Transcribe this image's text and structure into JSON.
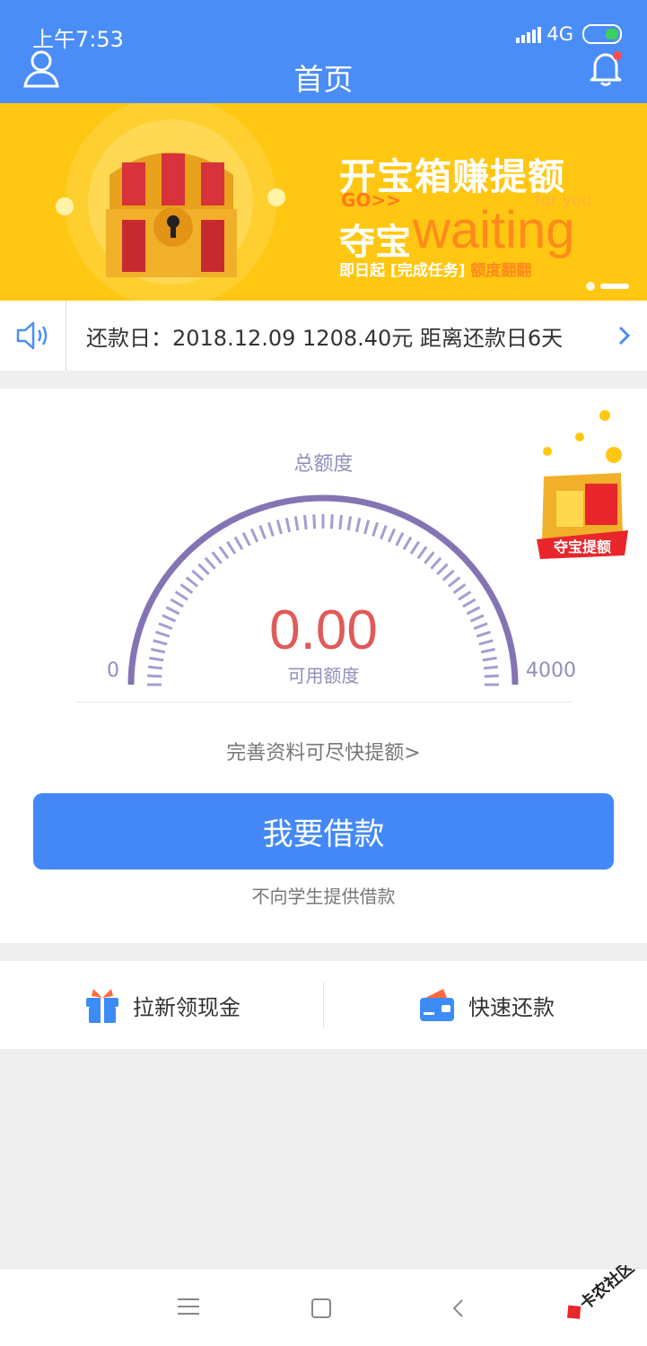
{
  "status_bar": {
    "time": "上午7:53",
    "network": "4G"
  },
  "header": {
    "title": "首页"
  },
  "banner": {
    "title": "开宝箱赚提额",
    "go_text": "GO>>",
    "duobao": "夺宝",
    "waiting": "waiting",
    "for_you": "for you",
    "subtitle_prefix": "即日起 [完成任务]",
    "subtitle_highlight": "额度翻翻",
    "page_count": 2,
    "active_page": 2
  },
  "notice": {
    "text": "还款日：2018.12.09  1208.40元  距离还款日6天"
  },
  "credit": {
    "total_label": "总额度",
    "amount": "0.00",
    "available_label": "可用额度",
    "min": "0",
    "max": "4000",
    "improve_link": "完善资料可尽快提额>",
    "borrow_button": "我要借款",
    "disclaimer": "不向学生提供借款",
    "treasure_badge": "夺宝提额"
  },
  "actions": [
    {
      "label": "拉新领现金",
      "icon": "gift-icon"
    },
    {
      "label": "快速还款",
      "icon": "card-icon"
    }
  ],
  "watermark": "卡农社区",
  "colors": {
    "header_blue": "#4a8df7",
    "banner_yellow": "#ffc711",
    "amount_red": "#e05a5a",
    "gauge_purple": "#8474b4",
    "button_blue": "#4388f6"
  }
}
